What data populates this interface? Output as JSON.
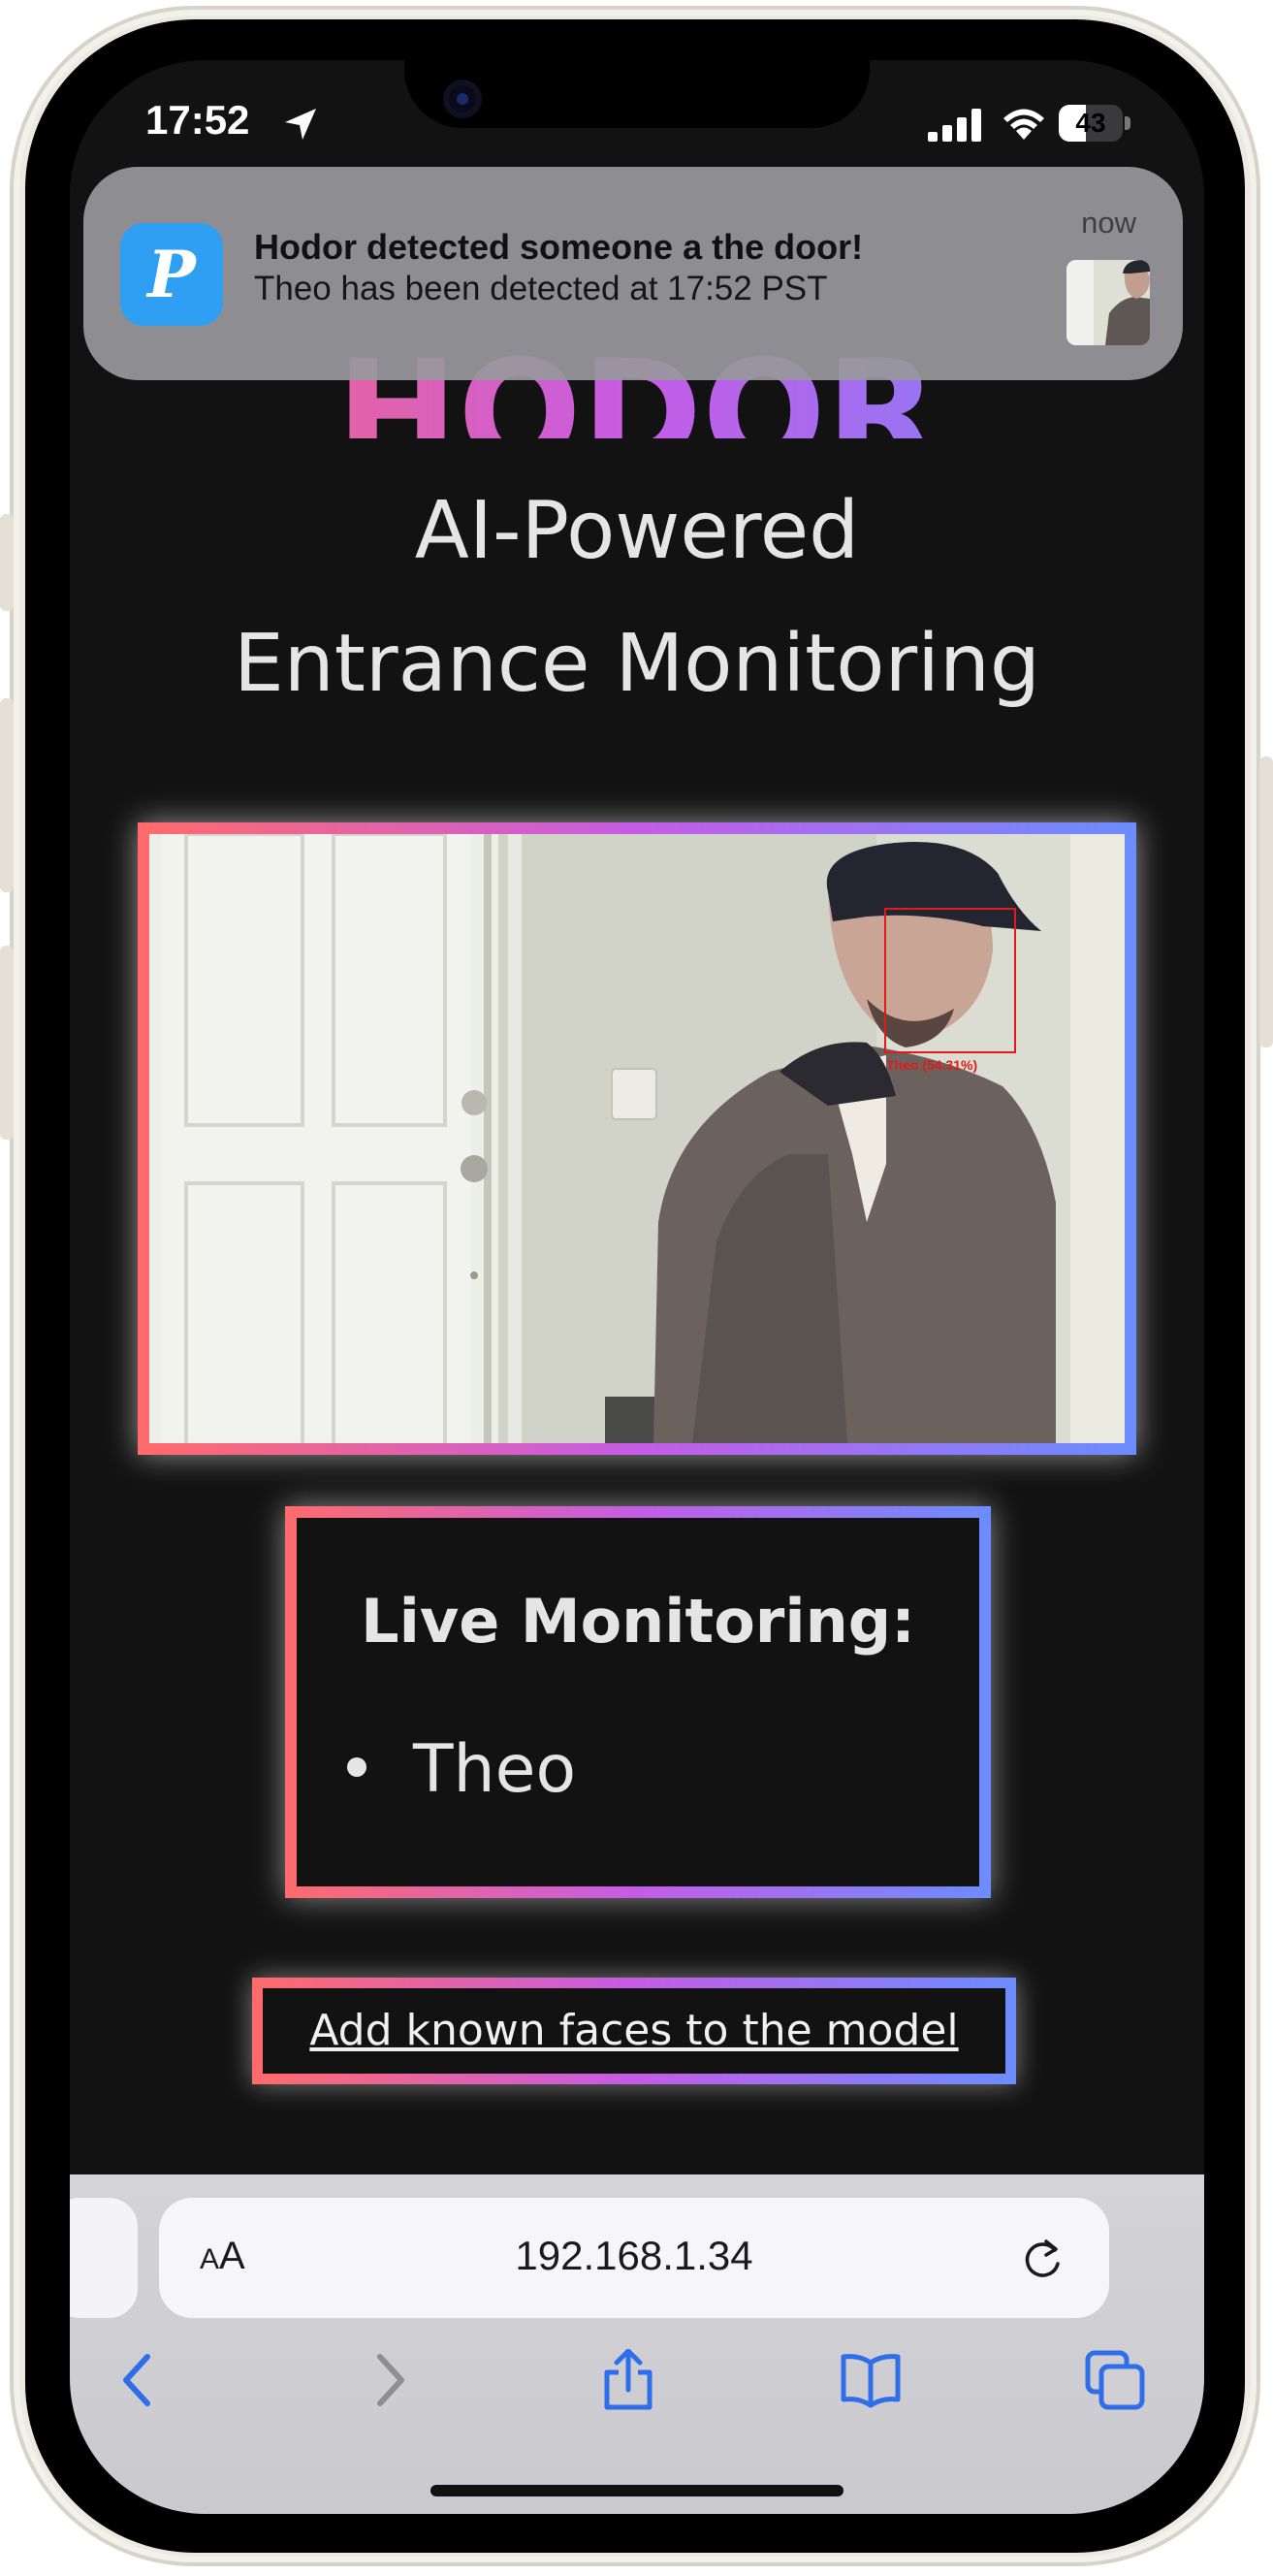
{
  "status_bar": {
    "time": "17:52",
    "battery": "43",
    "battery_level_percent": 43
  },
  "notification": {
    "app_icon_letter": "P",
    "title": "Hodor detected someone a the door!",
    "body": "Theo has been detected at 17:52 PST",
    "time": "now"
  },
  "page": {
    "title": "HODOR",
    "tagline_line1": "AI-Powered",
    "tagline_line2": "Entrance Monitoring",
    "camera_feed": {
      "detection_label": "Theo (54.31%)"
    },
    "live_monitoring": {
      "heading": "Live Monitoring:",
      "people": [
        "Theo"
      ]
    },
    "add_faces_link": "Add known faces to the model"
  },
  "browser": {
    "aa_label_small": "A",
    "aa_label_large": "A",
    "url": "192.168.1.34"
  },
  "colors": {
    "gradient_start": "#ff6b6b",
    "gradient_mid": "#c55ce6",
    "gradient_end": "#6b8dff",
    "page_background": "#121212",
    "safari_blue": "#2f6ee8"
  },
  "icons": {
    "status": [
      "location-arrow-icon",
      "cellular-signal-icon",
      "wifi-icon",
      "battery-icon"
    ],
    "browser": [
      "reload-icon",
      "back-chevron-icon",
      "forward-chevron-icon",
      "share-icon",
      "bookmarks-icon",
      "tabs-icon"
    ]
  }
}
